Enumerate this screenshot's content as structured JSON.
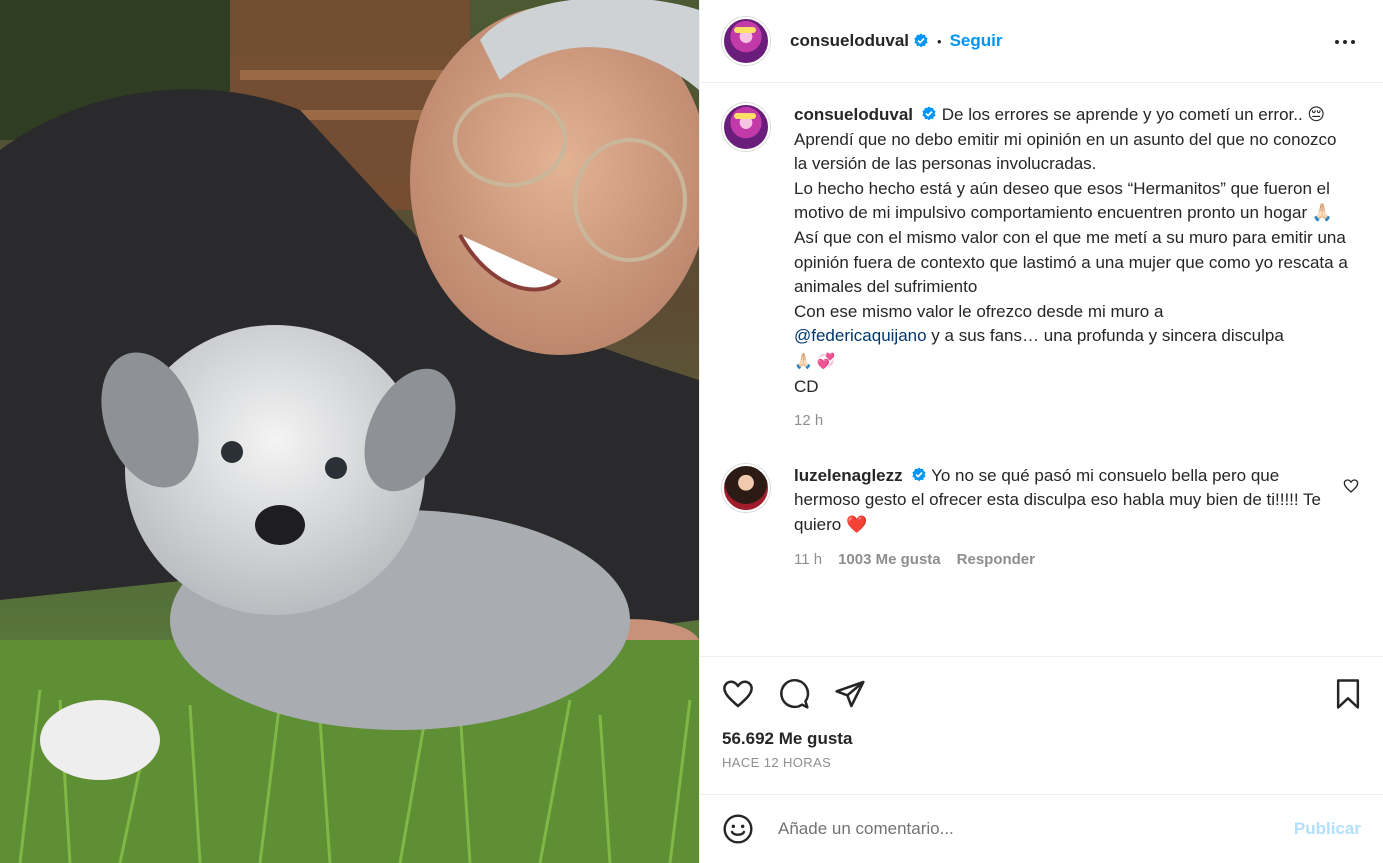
{
  "header": {
    "username": "consueloduval",
    "dot": "•",
    "follow_label": "Seguir",
    "more_icon": "more-horizontal-icon"
  },
  "caption": {
    "username": "consueloduval",
    "lines": [
      "De los errores se aprende y yo cometí un error.. 😔",
      "Aprendí que no debo emitir mi opinión en un asunto del que no conozco la versión de las personas involucradas.",
      "Lo hecho hecho está y aún deseo que esos “Hermanitos” que fueron el motivo de mi impulsivo comportamiento encuentren pronto un hogar 🙏🏻",
      "Así que con el mismo valor con el que me metí a su muro para emitir una opinión fuera de contexto que lastimó a una mujer que como yo rescata a animales del sufrimiento",
      "Con ese mismo valor le ofrezco desde mi muro a"
    ],
    "mention": "@federicaquijano",
    "mention_tail": " y a sus fans… una profunda y sincera disculpa",
    "emojis_line": "🙏🏻 💞",
    "signature": "CD",
    "time": "12 h"
  },
  "comment": {
    "username": "luzelenaglezz",
    "text": "Yo no se qué pasó mi consuelo bella pero que hermoso gesto el ofrecer esta disculpa eso habla muy bien de ti!!!!! Te quiero ❤️",
    "time": "11 h",
    "likes": "1003 Me gusta",
    "reply_label": "Responder"
  },
  "actions": {
    "icons": [
      "heart-icon",
      "comment-icon",
      "share-icon",
      "bookmark-icon"
    ],
    "likes": "56.692 Me gusta",
    "time_ago": "HACE 12 HORAS"
  },
  "add_comment": {
    "placeholder": "Añade un comentario...",
    "publish_label": "Publicar"
  },
  "colors": {
    "accent": "#0095f6",
    "publish_disabled": "#b2dffc",
    "mention": "#00376b",
    "verified": "#0095f6",
    "heart_red": "#ed4956"
  }
}
